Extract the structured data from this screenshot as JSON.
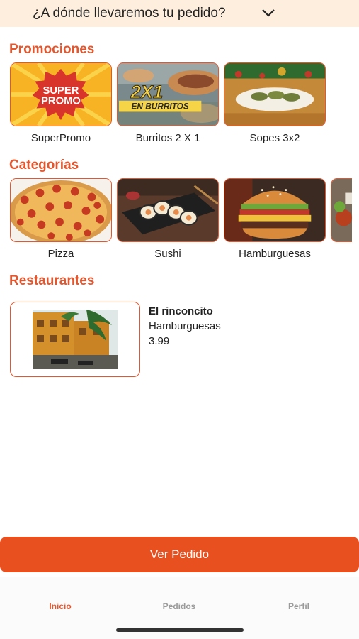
{
  "header": {
    "address_prompt": "¿A dónde llevaremos tu pedido?",
    "chevron_icon": "chevron-down-icon"
  },
  "sections": {
    "promotions": "Promociones",
    "categories": "Categorías",
    "restaurants": "Restaurantes"
  },
  "promotions": [
    {
      "label": "SuperPromo",
      "badge_text": "SUPER PROMO"
    },
    {
      "label": "Burritos 2 X 1",
      "badge_text": "2X1",
      "badge_sub": "EN BURRITOS"
    },
    {
      "label": "Sopes 3x2"
    }
  ],
  "categories": [
    {
      "label": "Pizza"
    },
    {
      "label": "Sushi"
    },
    {
      "label": "Hamburguesas"
    },
    {
      "label": ""
    }
  ],
  "restaurants": [
    {
      "name": "El rinconcito",
      "category": "Hamburguesas",
      "price": "3.99"
    }
  ],
  "order_button": "Ver Pedido",
  "tabs": [
    {
      "label": "Inicio",
      "active": true
    },
    {
      "label": "Pedidos",
      "active": false
    },
    {
      "label": "Perfil",
      "active": false
    }
  ],
  "colors": {
    "accent": "#e4572e",
    "button": "#e8501f",
    "header_bg": "#fdeede"
  }
}
